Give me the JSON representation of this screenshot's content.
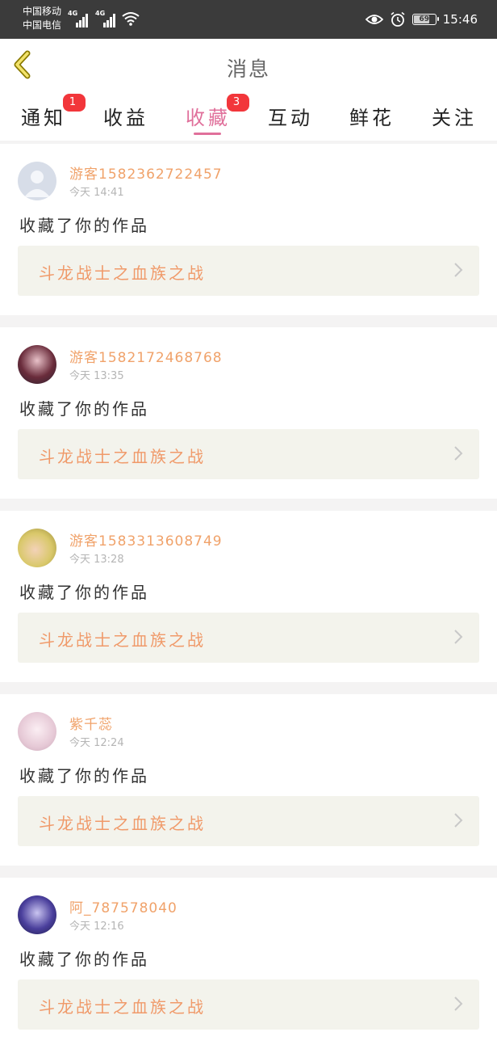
{
  "status_bar": {
    "carrier1": "中国移动",
    "carrier2": "中国电信",
    "net1": "4G",
    "net2": "4G",
    "battery": "69",
    "time": "15:46"
  },
  "header": {
    "title": "消息"
  },
  "tabs": [
    {
      "label": "通知",
      "badge": "1"
    },
    {
      "label": "收益",
      "badge": ""
    },
    {
      "label": "收藏",
      "badge": "3",
      "active": true
    },
    {
      "label": "互动",
      "badge": ""
    },
    {
      "label": "鲜花",
      "badge": ""
    },
    {
      "label": "关注",
      "badge": ""
    }
  ],
  "messages": [
    {
      "user": "游客1582362722457",
      "time": "今天 14:41",
      "action": "收藏了你的作品",
      "work": "斗龙战士之血族之战"
    },
    {
      "user": "游客1582172468768",
      "time": "今天 13:35",
      "action": "收藏了你的作品",
      "work": "斗龙战士之血族之战"
    },
    {
      "user": "游客1583313608749",
      "time": "今天 13:28",
      "action": "收藏了你的作品",
      "work": "斗龙战士之血族之战"
    },
    {
      "user": "紫千蕊",
      "time": "今天 12:24",
      "action": "收藏了你的作品",
      "work": "斗龙战士之血族之战"
    },
    {
      "user": "阿_787578040",
      "time": "今天 12:16",
      "action": "收藏了你的作品",
      "work": "斗龙战士之血族之战"
    }
  ],
  "colors": {
    "accent": "#e0709b",
    "username": "#f0a26a",
    "work_title": "#f09a6a",
    "badge": "#f2363b"
  },
  "icons": {
    "back": "chevron-left-icon",
    "work_link": "chevron-right-icon"
  }
}
